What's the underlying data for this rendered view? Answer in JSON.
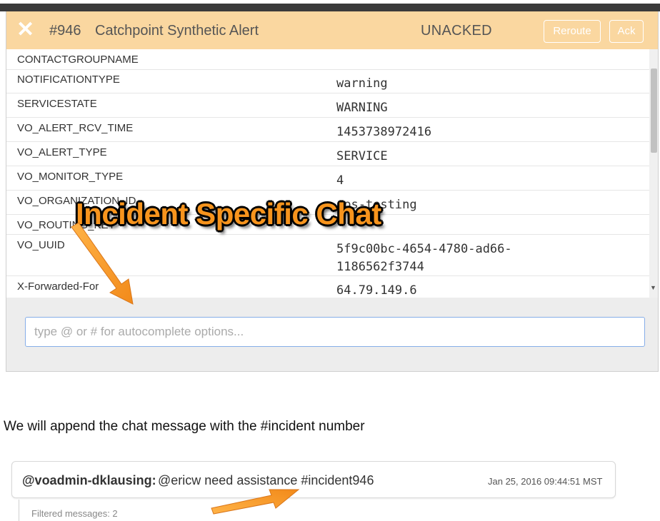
{
  "header": {
    "close_icon": "close-icon",
    "incident_number": "#946",
    "title": "Catchpoint Synthetic Alert",
    "status": "UNACKED",
    "reroute_label": "Reroute",
    "ack_label": "Ack",
    "background": "#fad7a0"
  },
  "fields": [
    {
      "key": "CONTACTGROUPNAME",
      "value": ""
    },
    {
      "key": "NOTIFICATIONTYPE",
      "value": "warning"
    },
    {
      "key": "SERVICESTATE",
      "value": "WARNING"
    },
    {
      "key": "VO_ALERT_RCV_TIME",
      "value": "1453738972416"
    },
    {
      "key": "VO_ALERT_TYPE",
      "value": "SERVICE"
    },
    {
      "key": "VO_MONITOR_TYPE",
      "value": "4"
    },
    {
      "key": "VO_ORGANIZATION_ID",
      "value": "ops-testing"
    },
    {
      "key": "VO_ROUTING_KEY",
      "value": ""
    },
    {
      "key": "VO_UUID",
      "value": "5f9c00bc-4654-4780-ad66-\n1186562f3744"
    },
    {
      "key": "X-Forwarded-For",
      "value": "64.79.149.6"
    }
  ],
  "chat": {
    "placeholder": "type @ or # for autocomplete options..."
  },
  "annotation": {
    "overlay_text": "Incident Specific Chat",
    "caption": "We will append the chat message with the #incident number",
    "arrow_color": "#f7941d"
  },
  "message": {
    "user": "@voadmin-dklausing:",
    "text": "@ericw need assistance #incident946",
    "timestamp": "Jan 25, 2016 09:44:51 MST",
    "filtered": "Filtered messages: 2"
  }
}
